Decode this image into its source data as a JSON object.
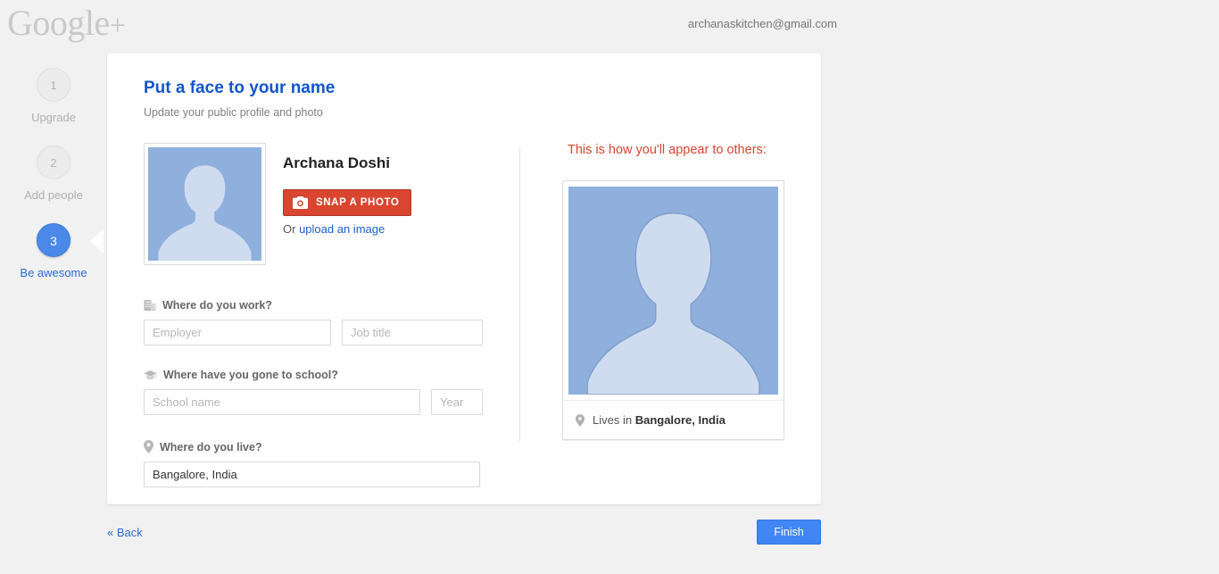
{
  "brand": {
    "name": "Google",
    "plus": "+"
  },
  "account": {
    "email": "archanaskitchen@gmail.com"
  },
  "steps": [
    {
      "number": "1",
      "label": "Upgrade",
      "active": false
    },
    {
      "number": "2",
      "label": "Add people",
      "active": false
    },
    {
      "number": "3",
      "label": "Be awesome",
      "active": true
    }
  ],
  "card": {
    "title": "Put a face to your name",
    "subtitle": "Update your public profile and photo"
  },
  "profile": {
    "name": "Archana Doshi",
    "avatar_icon": "person-placeholder-icon",
    "snap_button": "SNAP A PHOTO",
    "snap_icon": "camera-icon",
    "or_text": "Or",
    "upload_link": "upload an image"
  },
  "fields": {
    "work": {
      "label": "Where do you work?",
      "icon": "office-building-icon",
      "employer": {
        "placeholder": "Employer",
        "value": ""
      },
      "job_title": {
        "placeholder": "Job title",
        "value": ""
      }
    },
    "school": {
      "label": "Where have you gone to school?",
      "icon": "graduation-cap-icon",
      "school_name": {
        "placeholder": "School name",
        "value": ""
      },
      "year": {
        "placeholder": "Year",
        "value": ""
      }
    },
    "live": {
      "label": "Where do you live?",
      "icon": "location-pin-icon",
      "location": {
        "placeholder": "",
        "value": "Bangalore, India"
      }
    }
  },
  "preview": {
    "heading": "This is how you'll appear to others:",
    "photo_icon": "person-placeholder-icon",
    "location_icon": "location-pin-icon",
    "lives_in_prefix": "Lives in",
    "lives_in_value": "Bangalore, India"
  },
  "footer": {
    "back": "« Back",
    "finish": "Finish"
  },
  "colors": {
    "page_bg": "#f1f1f1",
    "accent_blue": "#4285f4",
    "title_blue": "#1155cc",
    "red": "#d9452f",
    "avatar_bg": "#8fb0dd",
    "avatar_fg": "#cfdcf0"
  }
}
